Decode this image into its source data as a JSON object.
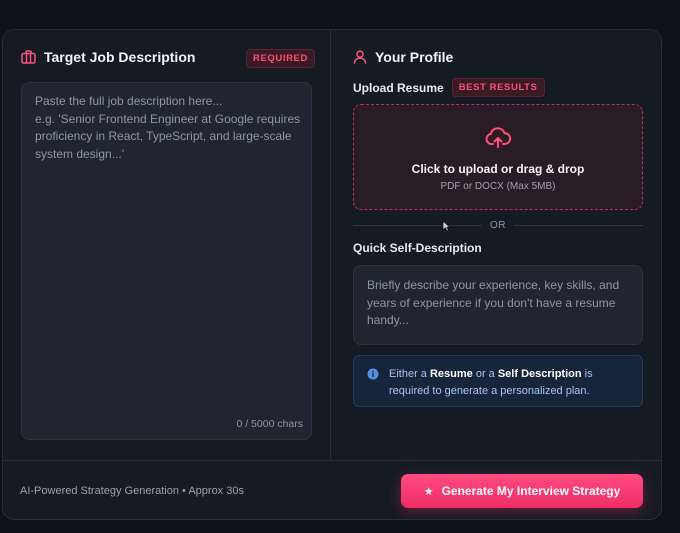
{
  "job_description": {
    "title": "Target Job Description",
    "badge": "REQUIRED",
    "placeholder": "Paste the full job description here...\ne.g. 'Senior Frontend Engineer at Google requires proficiency in React, TypeScript, and large-scale system design...'",
    "char_count": "0 / 5000 chars"
  },
  "profile": {
    "title": "Your Profile",
    "upload_label": "Upload Resume",
    "upload_badge": "BEST RESULTS",
    "dropzone_title": "Click to upload or drag & drop",
    "dropzone_subtitle": "PDF or DOCX (Max 5MB)",
    "or_text": "OR",
    "self_label": "Quick Self-Description",
    "self_placeholder": "Briefly describe your experience, key skills, and years of experience if you don't have a resume handy...",
    "info": {
      "part1": "Either a ",
      "resume": "Resume",
      "part2": " or a ",
      "self": "Self Description",
      "part3": " is required to generate a personalized plan."
    }
  },
  "footer": {
    "note": "AI-Powered Strategy Generation • Approx 30s",
    "cta_label": "Generate My Interview Strategy"
  },
  "icons": {
    "job": "briefcase-icon",
    "profile": "user-icon",
    "upload": "cloud-upload-icon",
    "info": "info-icon",
    "cta": "star-icon"
  },
  "colors": {
    "accent": "#ff4c80",
    "info_bg": "#17253c",
    "info_text": "#a9c4f0"
  }
}
